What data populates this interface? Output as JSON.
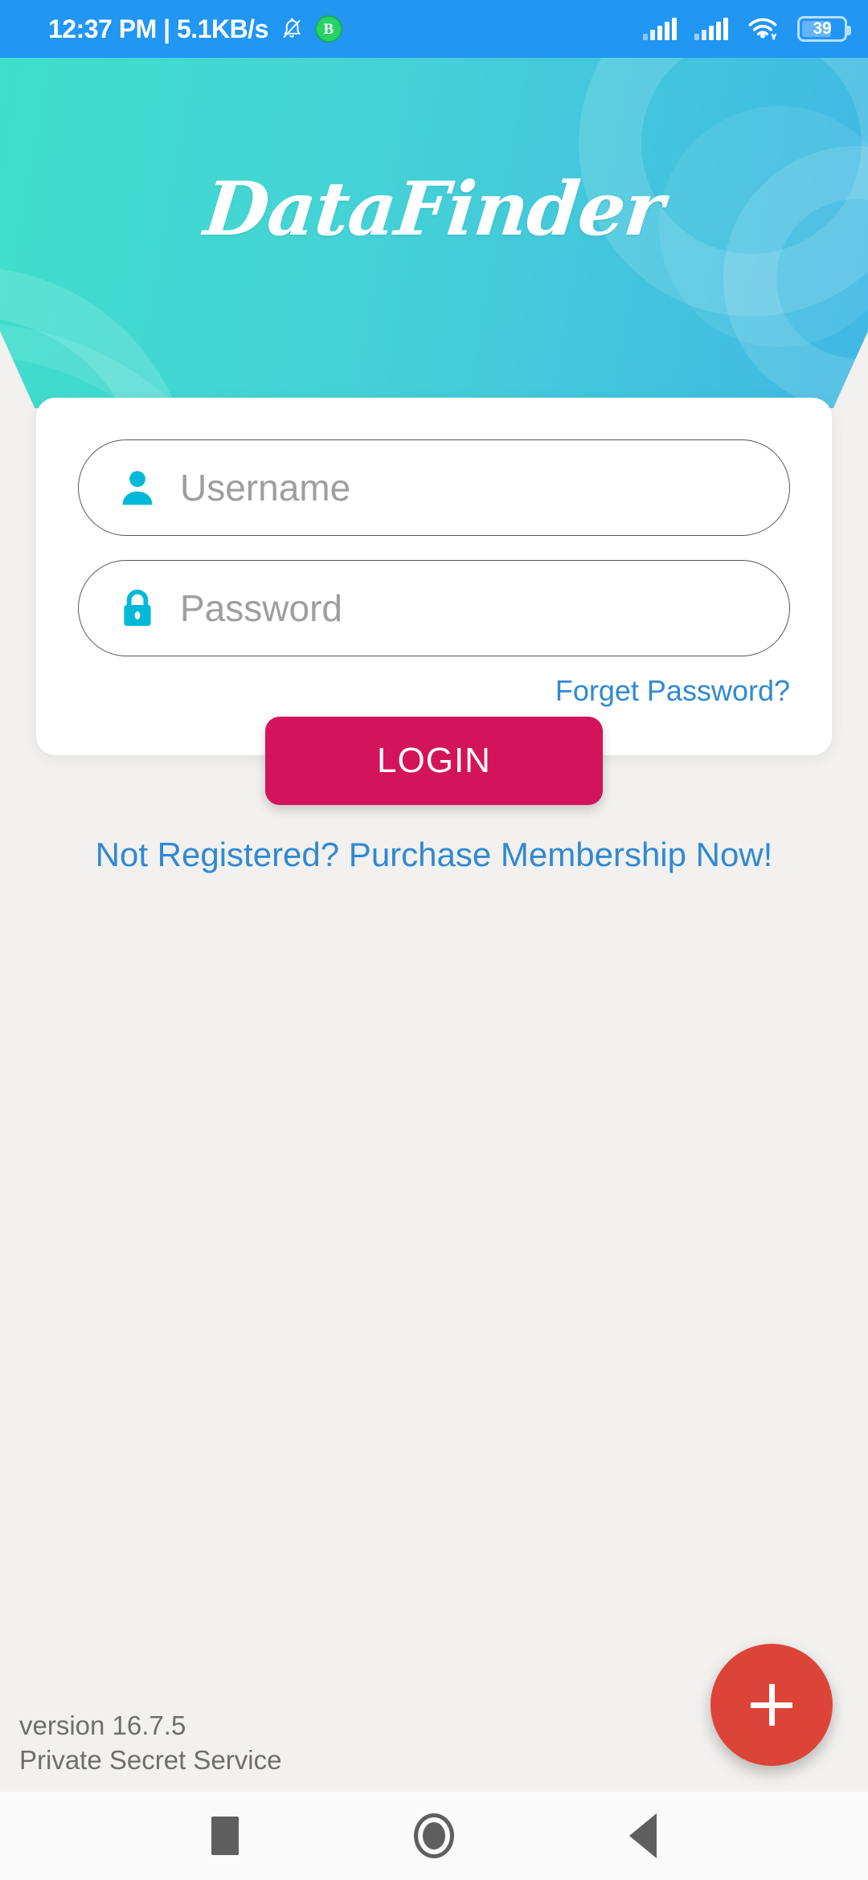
{
  "status_bar": {
    "clock": "12:37 PM | 5.1KB/s",
    "bell_icon": "bell-muted-icon",
    "whatsapp_badge_letter": "B",
    "signal_1_icon": "signal-bars-icon",
    "signal_2_icon": "signal-bars-icon",
    "wifi_icon": "wifi-icon",
    "battery_level": "39",
    "background_color": "#2196F3"
  },
  "header": {
    "logo_text": "DataFinder",
    "gradient_start": "#3FDFCB",
    "gradient_end": "#41B8E4"
  },
  "login_card": {
    "username": {
      "icon": "person-icon",
      "value": "",
      "placeholder": "Username"
    },
    "password": {
      "icon": "lock-icon",
      "value": "",
      "placeholder": "Password"
    },
    "forget_password_label": "Forget Password?",
    "link_color": "#3089D4"
  },
  "login_button": {
    "label": "LOGIN",
    "color": "#D4145A"
  },
  "register_link": {
    "label": "Not Registered? Purchase Membership Now!"
  },
  "footer": {
    "version": "version 16.7.5",
    "service": "Private Secret Service"
  },
  "fab": {
    "icon": "plus-icon",
    "color": "#DC4437"
  },
  "nav_bar": {
    "recents_icon": "square-recents-icon",
    "home_icon": "circle-home-icon",
    "back_icon": "triangle-back-icon"
  }
}
